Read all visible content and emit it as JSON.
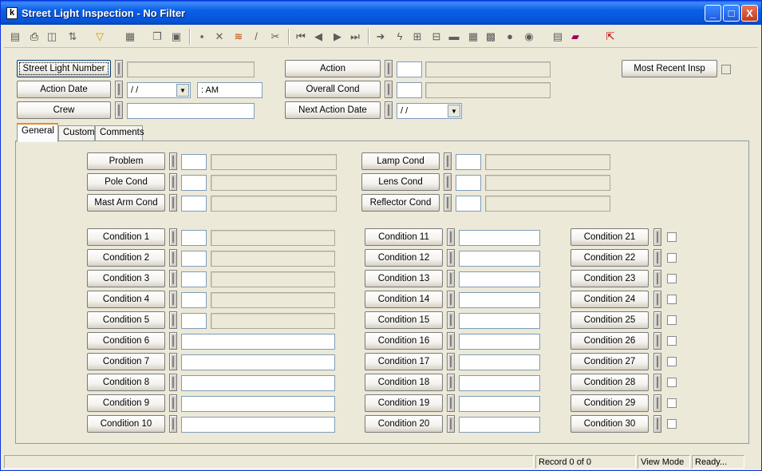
{
  "window": {
    "title": "Street Light Inspection - No Filter",
    "icon": "app-icon",
    "min": "_",
    "max": "□",
    "close": "X"
  },
  "toolbar": {
    "icons": [
      "grid-icon",
      "print-icon",
      "preview-icon",
      "sort-icon",
      "filter-icon",
      "report-icon",
      "copy-icon",
      "paste-icon",
      "save-icon",
      "delete-icon",
      "stack-icon",
      "edit-icon",
      "cut-icon",
      "first-icon",
      "prev-icon",
      "next-icon",
      "last-icon",
      "goto-icon",
      "lightning-icon",
      "tree-icon",
      "tree2-icon",
      "field-icon",
      "calc-icon",
      "image-icon",
      "speech-icon",
      "globe-icon",
      "table-icon",
      "book-icon",
      "exit-icon"
    ]
  },
  "header": {
    "street_light_number": {
      "label": "Street Light Number",
      "value": ""
    },
    "action_date": {
      "label": "Action Date",
      "date": " /  /",
      "time": " :  AM"
    },
    "crew": {
      "label": "Crew",
      "value": ""
    },
    "action": {
      "label": "Action",
      "code": "",
      "desc": ""
    },
    "overall_cond": {
      "label": "Overall Cond",
      "code": "",
      "desc": ""
    },
    "next_action_date": {
      "label": "Next Action Date",
      "date": " /  /"
    },
    "most_recent_insp": {
      "label": "Most Recent Insp"
    }
  },
  "tabs": [
    {
      "label": "General"
    },
    {
      "label": "Custom"
    },
    {
      "label": "Comments"
    }
  ],
  "general": {
    "left": [
      {
        "label": "Problem"
      },
      {
        "label": "Pole Cond"
      },
      {
        "label": "Mast Arm Cond"
      }
    ],
    "right": [
      {
        "label": "Lamp Cond"
      },
      {
        "label": "Lens Cond"
      },
      {
        "label": "Reflector Cond"
      }
    ],
    "conditions_col1": [
      "Condition 1",
      "Condition 2",
      "Condition 3",
      "Condition 4",
      "Condition 5",
      "Condition 6",
      "Condition 7",
      "Condition 8",
      "Condition 9",
      "Condition 10"
    ],
    "conditions_col2": [
      "Condition 11",
      "Condition 12",
      "Condition 13",
      "Condition 14",
      "Condition 15",
      "Condition 16",
      "Condition 17",
      "Condition 18",
      "Condition 19",
      "Condition 20"
    ],
    "conditions_col3": [
      "Condition 21",
      "Condition 22",
      "Condition 23",
      "Condition 24",
      "Condition 25",
      "Condition 26",
      "Condition 27",
      "Condition 28",
      "Condition 29",
      "Condition 30"
    ]
  },
  "status": {
    "record": "Record 0 of 0",
    "mode": "View Mode",
    "state": "Ready..."
  }
}
